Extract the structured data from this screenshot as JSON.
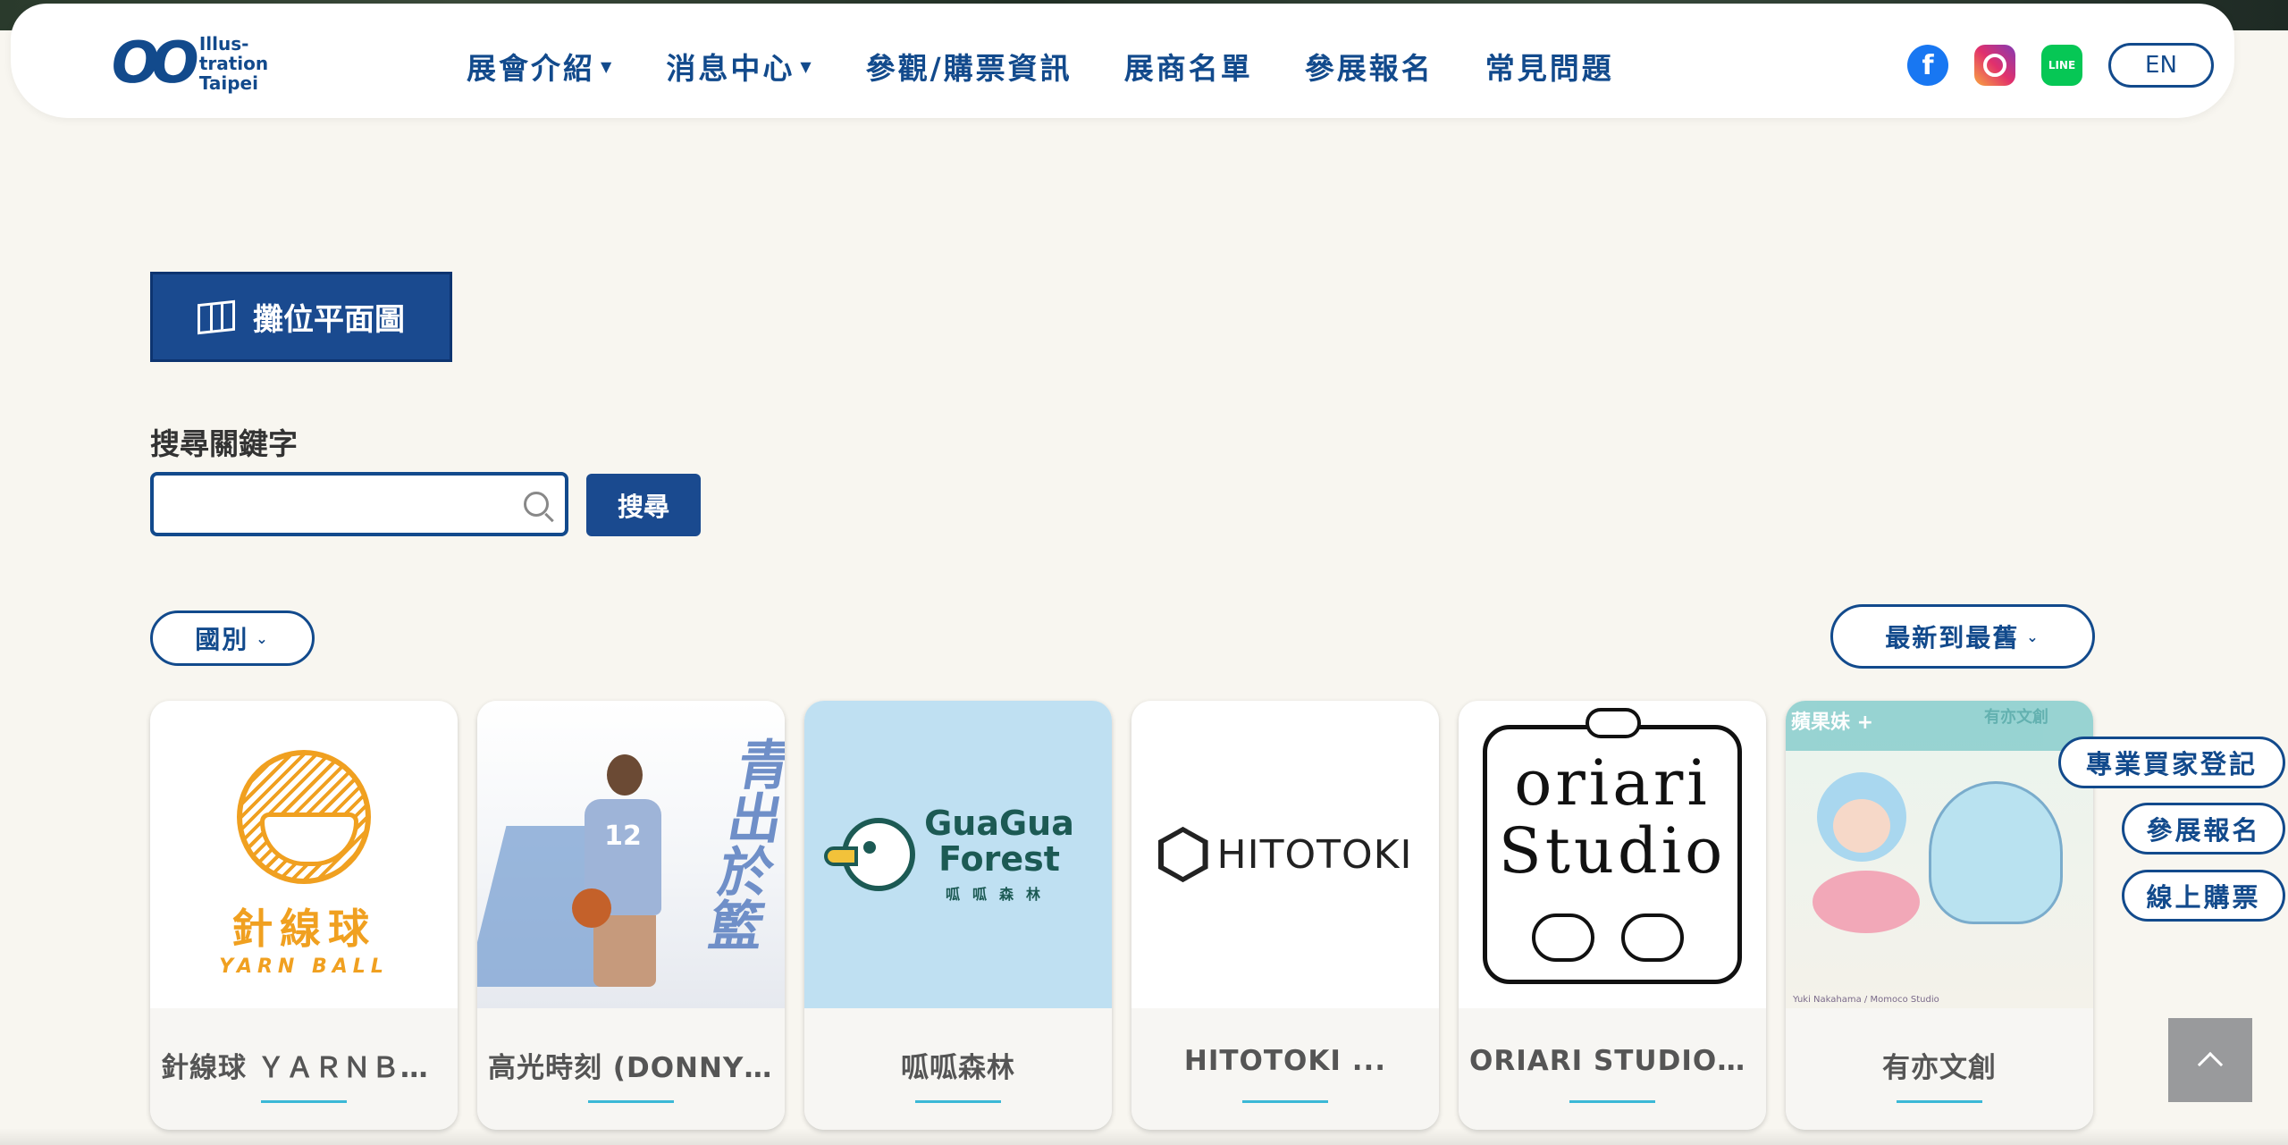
{
  "header": {
    "logo": {
      "mark": "OO",
      "lines": [
        "Illus-",
        "tration",
        "Taipei"
      ]
    },
    "nav": [
      {
        "label": "展會介紹",
        "has_dropdown": true
      },
      {
        "label": "消息中心",
        "has_dropdown": true
      },
      {
        "label": "參觀/購票資訊",
        "has_dropdown": false
      },
      {
        "label": "展商名單",
        "has_dropdown": false
      },
      {
        "label": "參展報名",
        "has_dropdown": false
      },
      {
        "label": "常見問題",
        "has_dropdown": false
      }
    ],
    "social_icons": [
      "facebook-icon",
      "instagram-icon",
      "line-icon"
    ],
    "line_text": "LINE",
    "lang_button": "EN"
  },
  "floorplan_button": {
    "label": "攤位平面圖",
    "icon": "map-icon"
  },
  "search": {
    "label": "搜尋關鍵字",
    "value": "",
    "placeholder": "",
    "button_label": "搜尋"
  },
  "filters": {
    "country": "國別",
    "sort": "最新到最舊"
  },
  "exhibitors": [
    {
      "title": "針線球 ＹＡＲＮＢＡ…",
      "art_cn": "針線球",
      "art_en": "YARN BALL"
    },
    {
      "title": "高光時刻 (DONNY YU…",
      "art_text": "青出於籃",
      "jersey": "12"
    },
    {
      "title": "呱呱森林",
      "art_line1": "GuaGua",
      "art_line2": "Forest",
      "art_line3": "呱呱森林"
    },
    {
      "title": "HITOTOKI ...",
      "art_text": "HITOTOKI"
    },
    {
      "title": "ORIARI STUDIO ...",
      "art_line1": "oriari",
      "art_line2": "Studio"
    },
    {
      "title": "有亦文創",
      "art_banner_left": "蘋果妹 +",
      "art_banner_right": "有亦文創",
      "credit": "Yuki Nakahama / Momoco Studio"
    }
  ],
  "floating_buttons": [
    "專業買家登記",
    "參展報名",
    "線上購票"
  ],
  "colors": {
    "primary": "#124a8c",
    "background": "#f8f6f0",
    "accent_underline": "#3bb8d6"
  }
}
